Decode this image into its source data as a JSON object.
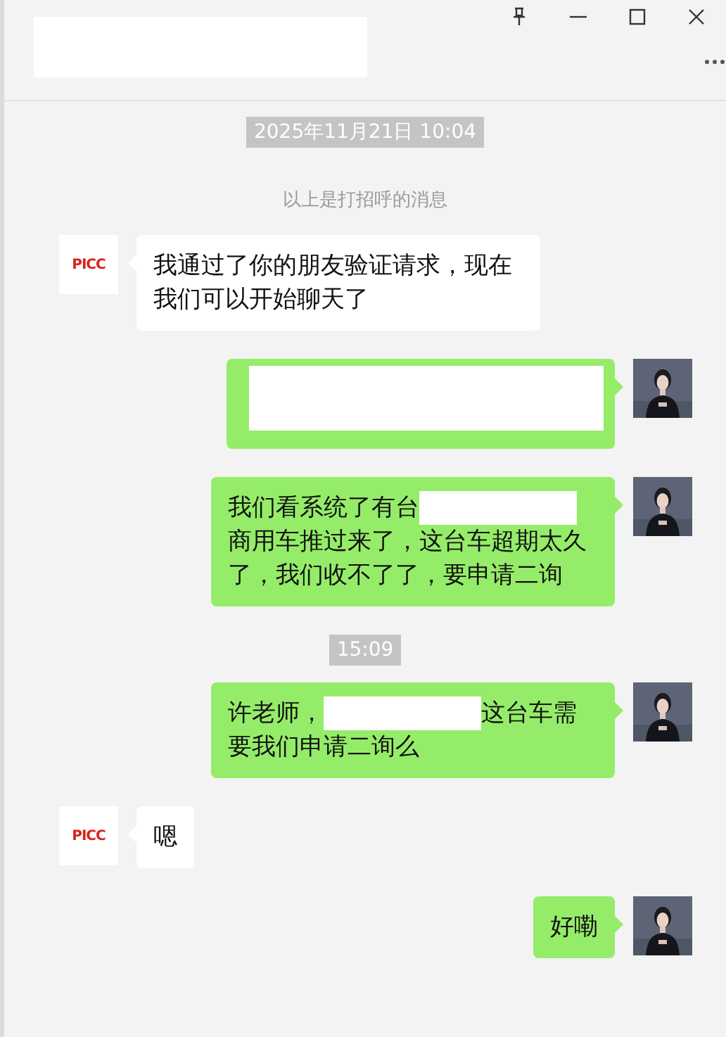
{
  "header": {
    "title": {
      "kind": "redacted"
    },
    "controls": [
      {
        "kind": "pin"
      },
      {
        "kind": "minimize"
      },
      {
        "kind": "maximize"
      },
      {
        "kind": "close"
      },
      {
        "kind": "more"
      }
    ]
  },
  "items": [
    {
      "kind": "time",
      "text": "2025年11月21日 10:04"
    },
    {
      "kind": "system",
      "text": "以上是打招呼的消息"
    },
    {
      "kind": "incoming",
      "avatar": {
        "kind": "logo",
        "text": "PICC"
      },
      "parts": [
        {
          "kind": "text",
          "text": "我通过了你的朋友验证请求，现在我们可以开始聊天了"
        }
      ]
    },
    {
      "kind": "outgoing",
      "parts": [
        {
          "kind": "redacted_block"
        }
      ]
    },
    {
      "kind": "outgoing",
      "parts": [
        {
          "kind": "text",
          "text": "我们看系统了有台"
        },
        {
          "kind": "redacted"
        },
        {
          "kind": "text",
          "text": "商用车推过来了，这台车超期太久了，我们收不了了，要申请二询"
        }
      ]
    },
    {
      "kind": "time",
      "text": "15:09"
    },
    {
      "kind": "outgoing",
      "parts": [
        {
          "kind": "text",
          "text": "许老师，"
        },
        {
          "kind": "redacted"
        },
        {
          "kind": "text",
          "text": "这台车需要我们申请二询么"
        }
      ]
    },
    {
      "kind": "incoming",
      "avatar": {
        "kind": "logo",
        "text": "PICC"
      },
      "parts": [
        {
          "kind": "text",
          "text": "嗯"
        }
      ]
    },
    {
      "kind": "outgoing",
      "parts": [
        {
          "kind": "text",
          "text": "好嘞"
        }
      ]
    }
  ]
}
